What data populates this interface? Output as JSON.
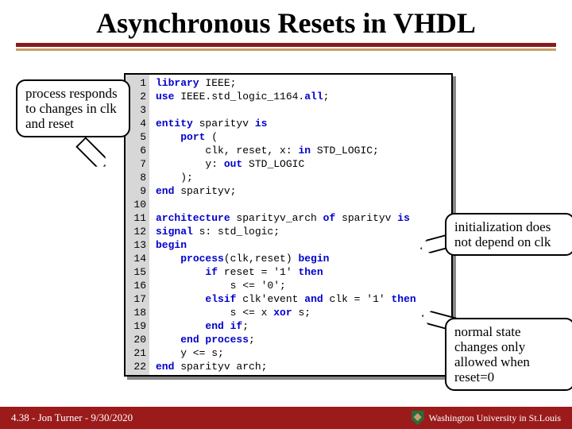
{
  "title": "Asynchronous Resets in VHDL",
  "code": {
    "lines": [
      {
        "n": "1",
        "t": [
          "library"
        ],
        "r": " IEEE;"
      },
      {
        "n": "2",
        "t": [
          "use"
        ],
        "r": " IEEE.std_logic_1164.",
        "t2": [
          "all"
        ],
        "r2": ";"
      },
      {
        "n": "3",
        "t": [],
        "r": " "
      },
      {
        "n": "4",
        "t": [
          "entity"
        ],
        "r": " sparityv ",
        "t2": [
          "is"
        ],
        "r2": ""
      },
      {
        "n": "5",
        "t": [],
        "r": "    ",
        "t2": [
          "port"
        ],
        "r2": " ("
      },
      {
        "n": "6",
        "t": [],
        "r": "        clk, reset, x: ",
        "t2": [
          "in"
        ],
        "r2": " STD_LOGIC;"
      },
      {
        "n": "7",
        "t": [],
        "r": "        y: ",
        "t2": [
          "out"
        ],
        "r2": " STD_LOGIC"
      },
      {
        "n": "8",
        "t": [],
        "r": "    );"
      },
      {
        "n": "9",
        "t": [
          "end"
        ],
        "r": " sparityv;"
      },
      {
        "n": "10",
        "t": [],
        "r": " "
      },
      {
        "n": "11",
        "t": [
          "architecture"
        ],
        "r": " sparityv_arch ",
        "t2": [
          "of"
        ],
        "r2": " sparityv ",
        "t3": [
          "is"
        ],
        "r3": ""
      },
      {
        "n": "12",
        "t": [
          "signal"
        ],
        "r": " s: std_logic;"
      },
      {
        "n": "13",
        "t": [
          "begin"
        ],
        "r": ""
      },
      {
        "n": "14",
        "t": [],
        "r": "    ",
        "t2": [
          "process"
        ],
        "r2": "(clk,reset) ",
        "t3": [
          "begin"
        ],
        "r3": ""
      },
      {
        "n": "15",
        "t": [],
        "r": "        ",
        "t2": [
          "if"
        ],
        "r2": " reset = '1' ",
        "t3": [
          "then"
        ],
        "r3": ""
      },
      {
        "n": "16",
        "t": [],
        "r": "            s <= '0';"
      },
      {
        "n": "17",
        "t": [],
        "r": "        ",
        "t2": [
          "elsif"
        ],
        "r2": " clk'event ",
        "t3": [
          "and"
        ],
        "r3": " clk = '1' ",
        "t4": [
          "then"
        ],
        "r4": ""
      },
      {
        "n": "18",
        "t": [],
        "r": "            s <= x ",
        "t2": [
          "xor"
        ],
        "r2": " s;"
      },
      {
        "n": "19",
        "t": [],
        "r": "        ",
        "t2": [
          "end if"
        ],
        "r2": ";"
      },
      {
        "n": "20",
        "t": [],
        "r": "    ",
        "t2": [
          "end process"
        ],
        "r2": ";"
      },
      {
        "n": "21",
        "t": [],
        "r": "    y <= s;"
      },
      {
        "n": "22",
        "t": [
          "end"
        ],
        "r": " sparityv arch;"
      }
    ]
  },
  "callouts": {
    "c1": "process responds to changes in clk and reset",
    "c2": "initialization does not depend on clk",
    "c3": "normal state changes only allowed when reset=0"
  },
  "footer": {
    "left": "4.38 - Jon Turner - 9/30/2020",
    "right": "Washington University in St.Louis"
  }
}
